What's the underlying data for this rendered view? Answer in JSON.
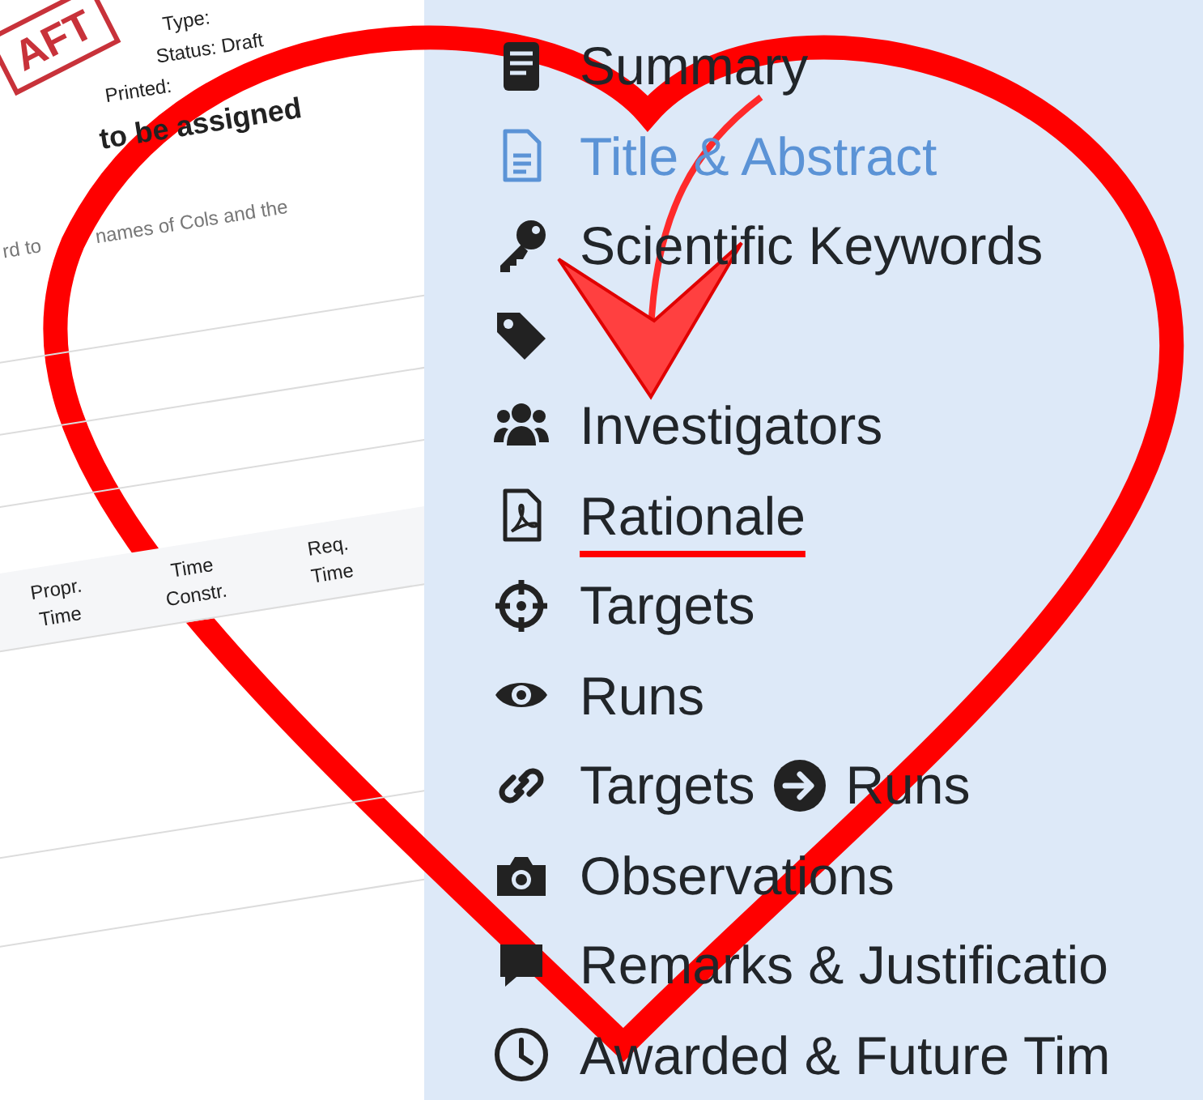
{
  "document": {
    "stamp": "AFT",
    "type_line": "Type:",
    "status": "Status: Draft",
    "printed": "Printed:",
    "heading": "to be assigned",
    "note_start": "rd to",
    "note_end": "names of Cols  and the",
    "table_headers": [
      {
        "line_1": "Propr.",
        "line_2": "Time"
      },
      {
        "line_1": "Time",
        "line_2": "Constr."
      },
      {
        "line_1": "Req.",
        "line_2": "Time"
      }
    ]
  },
  "sidebar": {
    "items": [
      {
        "kind": "summary",
        "label": "Summary",
        "selected": false,
        "underlined": false
      },
      {
        "kind": "title",
        "label": "Title & Abstract",
        "selected": true,
        "underlined": false
      },
      {
        "kind": "keywords",
        "label": "Scientific Keywords",
        "selected": false,
        "underlined": false
      },
      {
        "kind": "tag",
        "selected": false
      },
      {
        "kind": "investigators",
        "label": "Investigators",
        "selected": false,
        "underlined": false
      },
      {
        "kind": "rationale",
        "label": "Rationale",
        "selected": false,
        "underlined": true
      },
      {
        "kind": "targets",
        "label": "Targets",
        "selected": false,
        "underlined": false
      },
      {
        "kind": "runs",
        "label": "Runs",
        "selected": false,
        "underlined": false
      },
      {
        "kind": "link",
        "label": "Targets",
        "label_after": "Runs",
        "selected": false,
        "underlined": false
      },
      {
        "kind": "observations",
        "label": "Observations",
        "selected": false,
        "underlined": false
      },
      {
        "kind": "remarks",
        "label": "Remarks & Justificatio",
        "selected": false,
        "underlined": false
      },
      {
        "kind": "time",
        "label": "Awarded & Future Tim",
        "selected": false,
        "underlined": false
      }
    ]
  }
}
